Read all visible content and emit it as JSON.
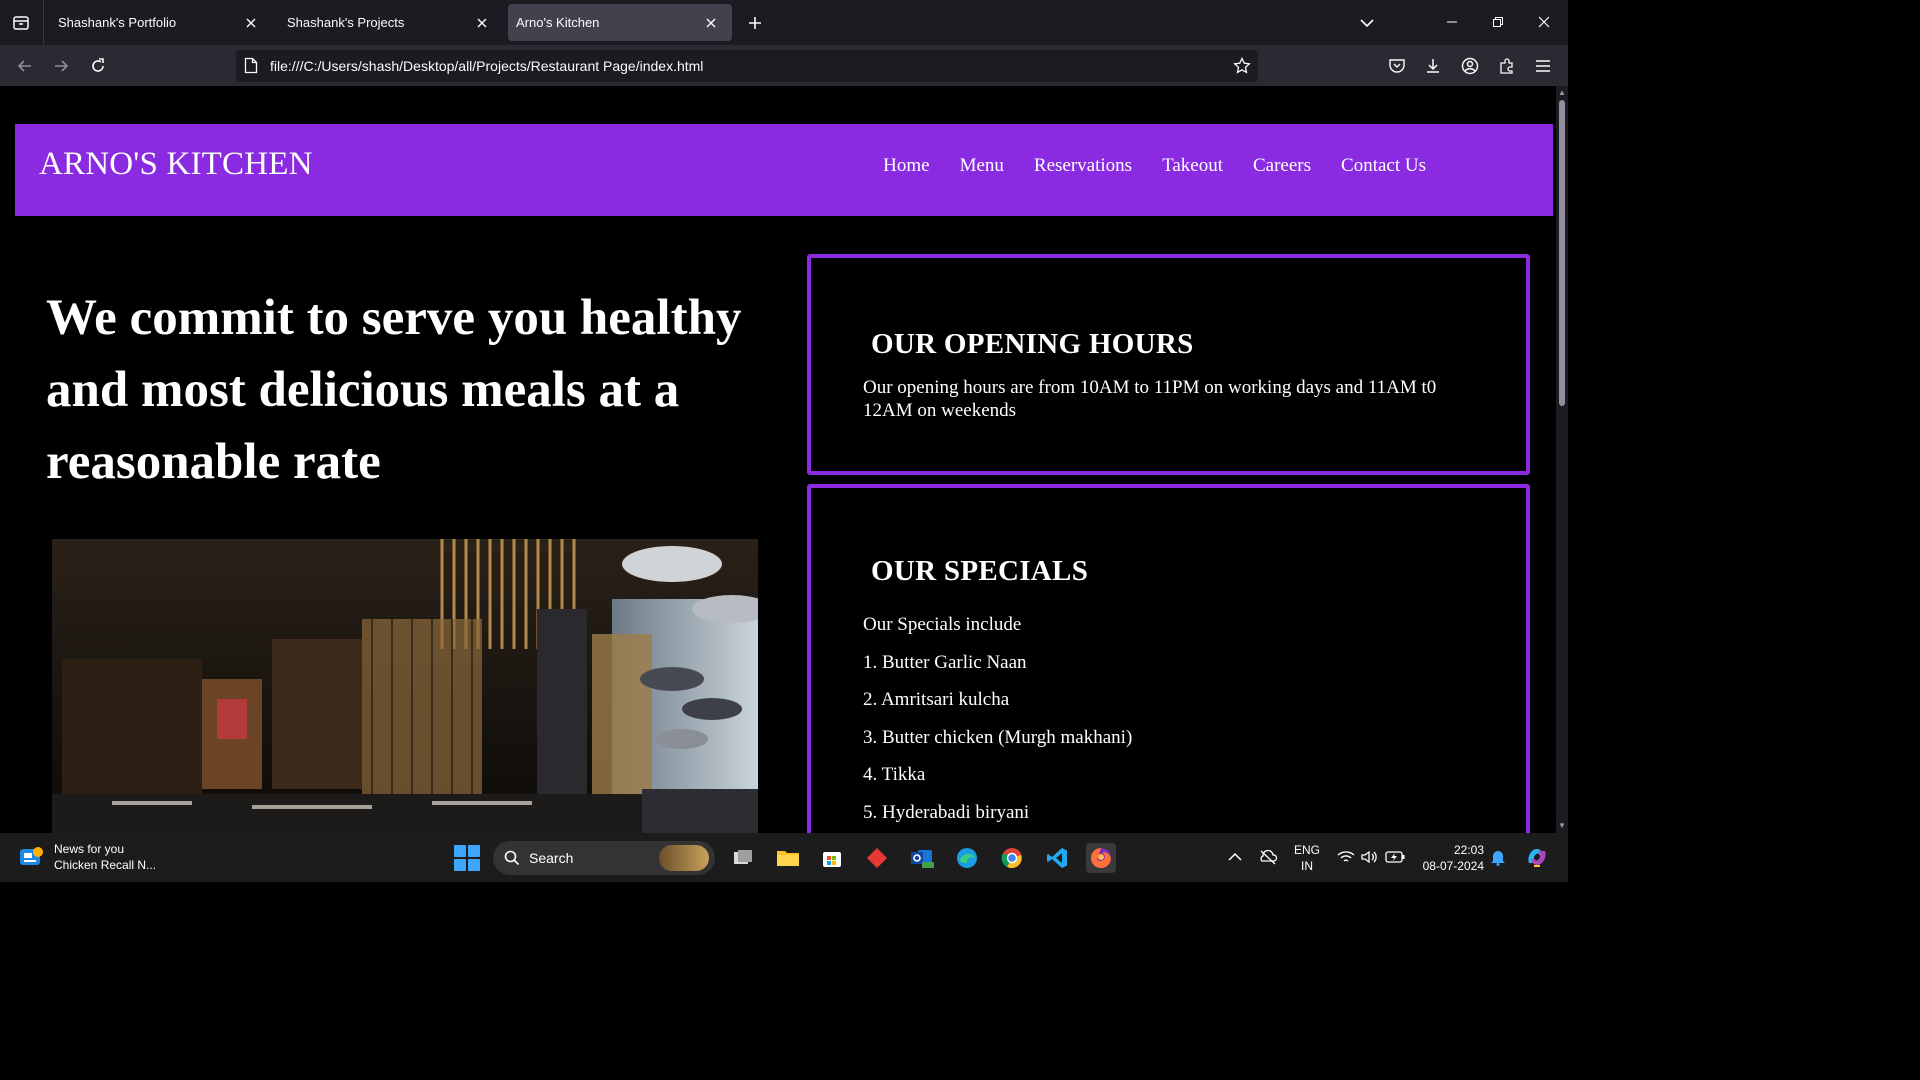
{
  "browser": {
    "tabs": [
      {
        "title": "Shashank's Portfolio",
        "active": false
      },
      {
        "title": "Shashank's Projects",
        "active": false
      },
      {
        "title": "Arno's Kitchen",
        "active": true
      }
    ],
    "url": "file:///C:/Users/shash/Desktop/all/Projects/Restaurant Page/index.html"
  },
  "site": {
    "logo": "ARNO'S KITCHEN",
    "nav": [
      "Home",
      "Menu",
      "Reservations",
      "Takeout",
      "Careers",
      "Contact Us"
    ],
    "hero_text": "We commit to serve you healthy and most delicious meals at a reasonable rate",
    "hours": {
      "title": "OUR OPENING HOURS",
      "text": "Our opening hours are from 10AM to 11PM on working days and 11AM t0 12AM on weekends"
    },
    "specials": {
      "title": "OUR SPECIALS",
      "intro": "Our Specials include",
      "items": [
        "1. Butter Garlic Naan",
        "2. Amritsari kulcha",
        "3. Butter chicken (Murgh makhani)",
        "4. Tikka",
        "5. Hyderabadi biryani"
      ]
    },
    "accent_color": "#8a2be2"
  },
  "taskbar": {
    "news_title": "News for you",
    "news_subtitle": "Chicken Recall N...",
    "search_label": "Search",
    "lang_top": "ENG",
    "lang_bottom": "IN",
    "time": "22:03",
    "date": "08-07-2024"
  }
}
